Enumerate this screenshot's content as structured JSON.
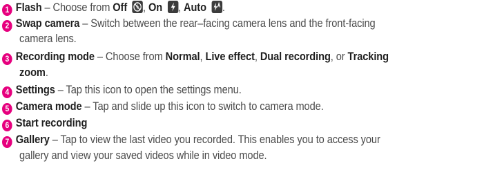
{
  "items": [
    {
      "num": "1",
      "term": "Flash",
      "sep": " – Choose from ",
      "opts": [
        {
          "label": "Off",
          "icon": "flash-off-icon"
        },
        {
          "label": "On",
          "icon": "flash-on-icon"
        },
        {
          "label": "Auto",
          "icon": "flash-auto-icon"
        }
      ],
      "comma": ",",
      "end": "."
    },
    {
      "num": "2",
      "term": "Swap camera",
      "text1": " – Switch between the rear–facing camera lens and the front-facing",
      "text2": "camera lens."
    },
    {
      "num": "3",
      "term": "Recording mode",
      "sep": " – Choose from ",
      "o1": "Normal",
      "o2": "Live effect",
      "o3": "Dual recording",
      "or": ", or ",
      "o4a": "Tracking",
      "o4b": "zoom",
      "comma": ",",
      "end": "."
    },
    {
      "num": "4",
      "term": "Settings",
      "text": " – Tap this icon to open the settings menu."
    },
    {
      "num": "5",
      "term": "Camera mode",
      "text": " – Tap and slide up this icon to switch to camera mode."
    },
    {
      "num": "6",
      "term": "Start recording"
    },
    {
      "num": "7",
      "term": "Gallery",
      "text1": " – Tap to view the last video you recorded. This enables you to access your",
      "text2": "gallery and view your saved videos while in video mode."
    }
  ]
}
